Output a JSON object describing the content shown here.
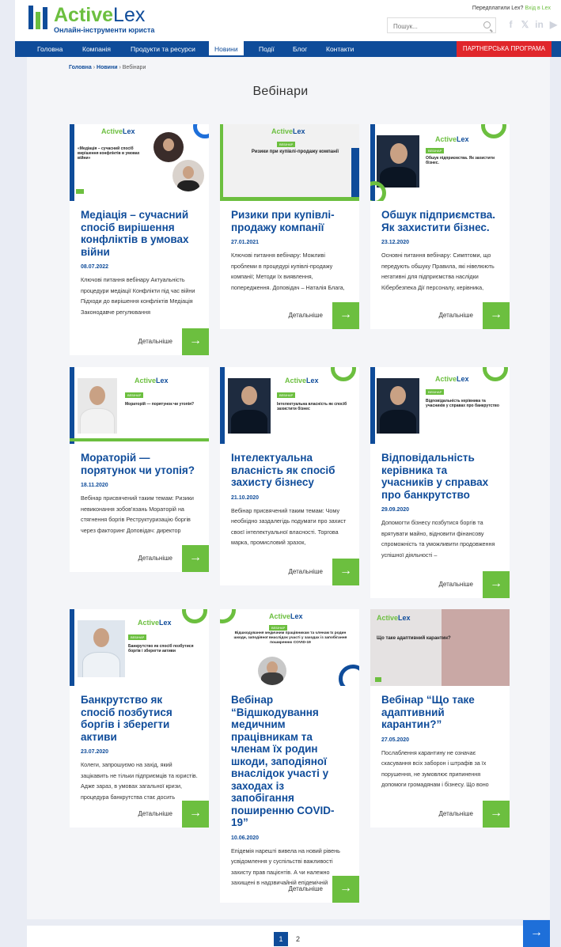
{
  "header": {
    "logo_main": "Active",
    "logo_accent": "Lex",
    "logo_sub": "Онлайн-інструменти юриста",
    "preorder_text": "Передплатили Lex?",
    "preorder_link": "Вхід в Lex",
    "search_placeholder": "Пошук...",
    "social": [
      "f",
      "𝕏",
      "in",
      "▶"
    ]
  },
  "nav": {
    "items": [
      "Головна",
      "Компанія",
      "Продукти та ресурси",
      "Новини",
      "Події",
      "Блог",
      "Контакти"
    ],
    "active": "Новини",
    "partner": "ПАРТНЕРСЬКА ПРОГРАМА"
  },
  "breadcrumb": {
    "home": "Головна",
    "news": "Новини",
    "current": "Вебінари",
    "sep": "›"
  },
  "page_title": "Вебінари",
  "more_label": "Детальніше",
  "cards": [
    {
      "title": "Медіація – сучасний спосіб вирішення конфліктів в умовах війни",
      "date": "08.07.2022",
      "desc": "Ключові питання вебінару Актуальність процедури медіації Конфлікти під час війни Підходи до вирішення конфліктів Медіація Законодавче регулювання",
      "img_title": "«Медіація – сучасний спосіб вирішення конфліктів в умовах війни»"
    },
    {
      "title": "Ризики при купівлі-продажу компанії",
      "date": "27.01.2021",
      "desc": "Ключові питання вебінару: Можливі проблеми в процедурі купівлі-продажу компанії; Методи їх виявлення, попередження. Доповідач – Наталія Блага,",
      "img_title": "Ризики при купівлі-продажу компанії"
    },
    {
      "title": "Обшук підприємства. Як захистити бізнес.",
      "date": "23.12.2020",
      "desc": "Основні питання вебінару: Симптоми, що передують обшуку Правила, які нівелюють негативні для підприємства наслідки Кібербезпека Дії персоналу, керівника,",
      "img_title": "Обшук підприємства. Як захистити бізнес."
    },
    {
      "title": "Мораторій — порятунок чи утопія?",
      "date": "18.11.2020",
      "desc": "Вебінар присвячений таким темам: Ризики невиконання зобов'язань Мораторій на стягнення боргів Реструктуризацію боргів через факторинг Доповідач: директор",
      "img_title": "Мораторій — порятунок чи утопія?"
    },
    {
      "title": "Інтелектуальна власність як спосіб захисту бізнесу",
      "date": "21.10.2020",
      "desc": "Вебінар присвячений таким темам: Чому необхідно заздалегідь подумати про захист своєї інтелектуальної власності. Торгова марка, промисловий зразок,",
      "img_title": "Інтелектуальна власність як спосіб захистити бізнес"
    },
    {
      "title": "Відповідальність керівника та учасників у справах про банкрутство",
      "date": "29.09.2020",
      "desc": "Допомогти бізнесу позбутися боргів та врятувати майно, відновити фінансову спроможність та уможливити продовження успішної діяльності –",
      "img_title": "Відповідальність керівника та учасників у справах про банкрутство"
    },
    {
      "title": "Банкрутство як спосіб позбутися боргів і зберегти активи",
      "date": "23.07.2020",
      "desc": "Колеги, запрошуємо на захід, який зацікавить не тільки підприємців та юристів. Адже зараз, в умовах загальної кризи, процедура банкрутства стає досить",
      "img_title": "Банкрутство як спосіб позбутися боргів і зберегти активи"
    },
    {
      "title": "Вебінар “Відшкодування медичним працівникам та членам їх родин шкоди, заподіяної внаслідок участі у заходах із запобігання поширенню COVID-19”",
      "date": "10.06.2020",
      "desc": "Епідемія нарешті вивела на новий рівень усвідомлення у суспільстві важливості захисту прав пацієнтів. А чи належно захищені в надзвичайній епідемічній",
      "img_title": "Відшкодування медичним працівникам та членам їх родин шкоди, заподіяної внаслідок участі у заходах із запобігання поширенню COVID-19"
    },
    {
      "title": "Вебінар “Що таке адаптивний карантин?”",
      "date": "27.05.2020",
      "desc": "Послаблення карантину не означає скасування всіх заборон і штрафів за їх порушення, не зумовлює припинення допомоги громадянам і бізнесу. Що воно",
      "img_title": "Що таке адаптивний карантин?"
    }
  ],
  "pagination": {
    "pages": [
      "1",
      "2"
    ],
    "current": "1",
    "next": "→"
  },
  "colors": {
    "brand_blue": "#0f4c9a",
    "brand_green": "#6cbf3f",
    "partner_red": "#e0262b"
  }
}
